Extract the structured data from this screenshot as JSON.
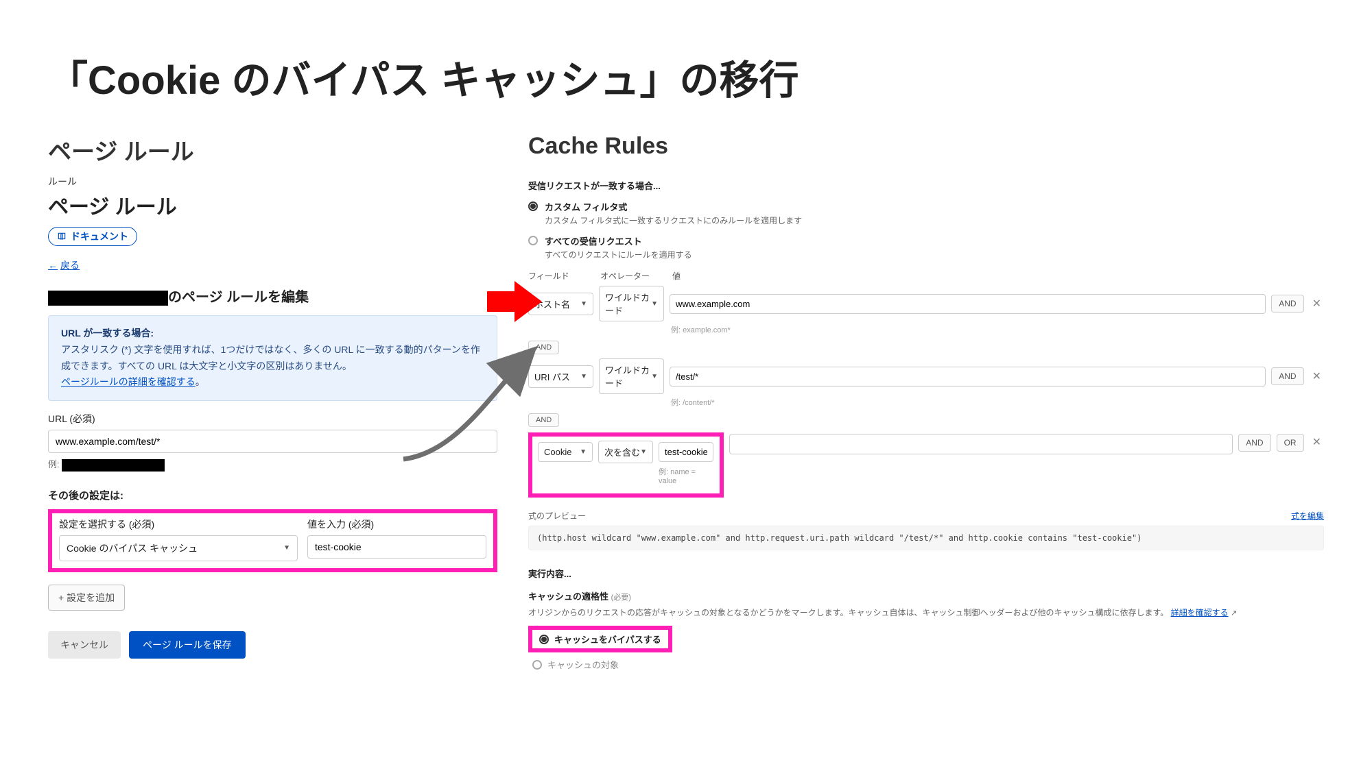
{
  "title": "「Cookie のバイパス キャッシュ」の移行",
  "left": {
    "col_head": "ページ ルール",
    "sub_label": "ルール",
    "page_rules_title": "ページ ルール",
    "doc_pill": "ドキュメント",
    "back": "戻る",
    "edit_heading_suffix": "のページ ルールを編集",
    "info_title": "URL が一致する場合:",
    "info_body": "アスタリスク (*) 文字を使用すれば、1つだけではなく、多くの URL に一致する動的パターンを作成できます。すべての URL は大文字と小文字の区別はありません。",
    "info_link": "ページルールの詳細を確認する",
    "info_period": "。",
    "url_label": "URL (必須)",
    "url_value": "www.example.com/test/*",
    "example_label": "例:",
    "after_settings": "その後の設定は:",
    "select_label": "設定を選択する (必須)",
    "select_value": "Cookie のバイパス キャッシュ",
    "value_label": "値を入力 (必須)",
    "value_value": "test-cookie",
    "add_setting": "+ 設定を追加",
    "cancel": "キャンセル",
    "save": "ページ ルールを保存"
  },
  "right": {
    "col_head": "Cache Rules",
    "incoming": "受信リクエストが一致する場合...",
    "radio1_label": "カスタム フィルタ式",
    "radio1_desc": "カスタム フィルタ式に一致するリクエストにのみルールを適用します",
    "radio2_label": "すべての受信リクエスト",
    "radio2_desc": "すべてのリクエストにルールを適用する",
    "head_field": "フィールド",
    "head_operator": "オペレーター",
    "head_value": "値",
    "row1": {
      "field": "ホスト名",
      "op": "ワイルドカード",
      "val": "www.example.com",
      "ex": "例: example.com*"
    },
    "row2": {
      "field": "URI パス",
      "op": "ワイルドカード",
      "val": "/test/*",
      "ex": "例: /content/*"
    },
    "row3": {
      "field": "Cookie",
      "op": "次を含む",
      "val": "test-cookie",
      "ex": "例: name = value"
    },
    "and": "AND",
    "or": "OR",
    "preview_label": "式のプレビュー",
    "preview_link": "式を編集",
    "code": "(http.host wildcard \"www.example.com\" and http.request.uri.path wildcard \"/test/*\" and http.cookie contains \"test-cookie\")",
    "exec_head": "実行内容...",
    "elig_head": "キャッシュの適格性",
    "required": "(必要)",
    "elig_desc_a": "オリジンからのリクエストの応答がキャッシュの対象となるかどうかをマークします。キャッシュ自体は、キャッシュ制御ヘッダーおよび他のキャッシュ構成に依存します。",
    "elig_link": "詳細を確認する",
    "elig_opt1": "キャッシュをバイパスする",
    "elig_opt2": "キャッシュの対象"
  }
}
